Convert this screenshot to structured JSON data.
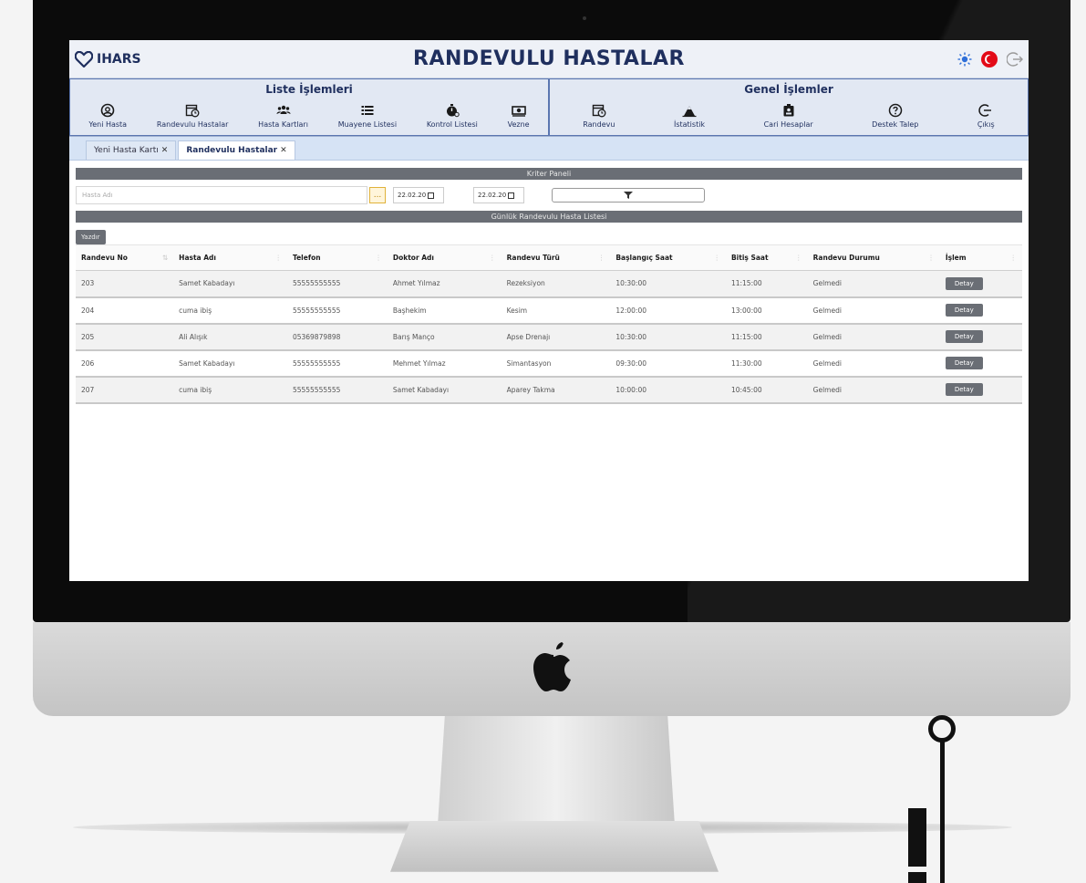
{
  "app": {
    "logo_text": "IHARS",
    "page_title": "RANDEVULU HASTALAR"
  },
  "header_icons": [
    "theme-toggle-icon",
    "turkish-flag-icon",
    "exit-icon"
  ],
  "menu": {
    "liste": {
      "title": "Liste İşlemleri",
      "items": [
        {
          "label": "Yeni Hasta",
          "icon": "user-circle-icon"
        },
        {
          "label": "Randevulu Hastalar",
          "icon": "calendar-clock-icon"
        },
        {
          "label": "Hasta Kartları",
          "icon": "users-icon"
        },
        {
          "label": "Muayene Listesi",
          "icon": "list-icon"
        },
        {
          "label": "Kontrol Listesi",
          "icon": "stopwatch-icon"
        },
        {
          "label": "Vezne",
          "icon": "cash-icon"
        }
      ]
    },
    "genel": {
      "title": "Genel İşlemler",
      "items": [
        {
          "label": "Randevu",
          "icon": "calendar-clock-icon"
        },
        {
          "label": "İstatistik",
          "icon": "chart-icon"
        },
        {
          "label": "Cari Hesaplar",
          "icon": "id-badge-icon"
        },
        {
          "label": "Destek Talep",
          "icon": "help-icon"
        },
        {
          "label": "Çıkış",
          "icon": "logout-icon"
        }
      ]
    }
  },
  "tabs": [
    {
      "label": "Yeni Hasta Kartı",
      "active": false
    },
    {
      "label": "Randevulu Hastalar",
      "active": true
    }
  ],
  "criteria": {
    "title": "Kriter Paneli",
    "name_placeholder": "Hasta Adı",
    "dots_label": "...",
    "date_from": "22.02.20",
    "date_to": "22.02.20"
  },
  "list": {
    "title": "Günlük Randevulu Hasta Listesi",
    "print_label": "Yazdır",
    "columns": [
      "Randevu No",
      "Hasta Adı",
      "Telefon",
      "Doktor Adı",
      "Randevu Türü",
      "Başlangıç Saat",
      "Bitiş Saat",
      "Randevu Durumu",
      "İşlem"
    ],
    "rows": [
      [
        "203",
        "Samet Kabadayı",
        "55555555555",
        "Ahmet Yılmaz",
        "Rezeksiyon",
        "10:30:00",
        "11:15:00",
        "Gelmedi",
        "Detay"
      ],
      [
        "204",
        "cuma ibiş",
        "55555555555",
        "Başhekim",
        "Kesim",
        "12:00:00",
        "13:00:00",
        "Gelmedi",
        "Detay"
      ],
      [
        "205",
        "Ali Alışık",
        "05369879898",
        "Barış Manço",
        "Apse Drenajı",
        "10:30:00",
        "11:15:00",
        "Gelmedi",
        "Detay"
      ],
      [
        "206",
        "Samet Kabadayı",
        "55555555555",
        "Mehmet Yılmaz",
        "Simantasyon",
        "09:30:00",
        "11:30:00",
        "Gelmedi",
        "Detay"
      ],
      [
        "207",
        "cuma ibiş",
        "55555555555",
        "Samet Kabadayı",
        "Aparey Takma",
        "10:00:00",
        "10:45:00",
        "Gelmedi",
        "Detay"
      ]
    ]
  }
}
